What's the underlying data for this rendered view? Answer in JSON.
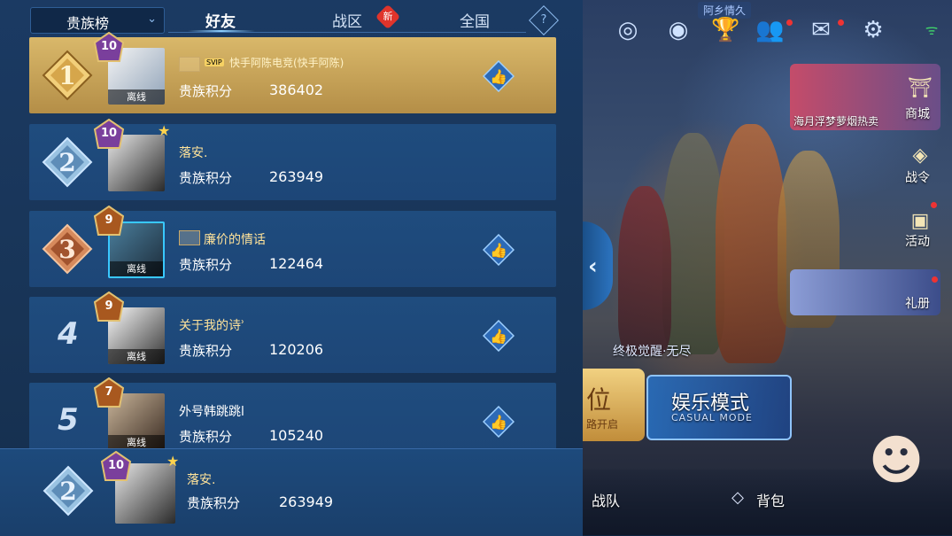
{
  "header": {
    "rank_select": "贵族榜",
    "tabs": [
      {
        "label": "好友",
        "active": true
      },
      {
        "label": "战区",
        "active": false,
        "badge": "新"
      },
      {
        "label": "全国",
        "active": false
      }
    ],
    "help_glyph": "?"
  },
  "colors": {
    "panel": "#1b3a63",
    "row": "#1f4c7e",
    "first_row": "#d9b86a",
    "accent": "#8fd0ff"
  },
  "rows": [
    {
      "rank": "1",
      "level": "10",
      "status": "离线",
      "badge": "SVIP",
      "name": "快手阿陈电竞(快手阿陈)",
      "score_label": "贵族积分",
      "score": "386402",
      "like": true
    },
    {
      "rank": "2",
      "level": "10",
      "status": "",
      "name": "落安.",
      "score_label": "贵族积分",
      "score": "263949",
      "like": false
    },
    {
      "rank": "3",
      "level": "9",
      "status": "离线",
      "name": "廉价的情话",
      "score_label": "贵族积分",
      "score": "122464",
      "like": true
    },
    {
      "rank": "4",
      "level": "9",
      "status": "离线",
      "name": "关于我的诗ʾ",
      "score_label": "贵族积分",
      "score": "120206",
      "like": true
    },
    {
      "rank": "5",
      "level": "7",
      "status": "离线",
      "name": "外号韩跳跳l",
      "score_label": "贵族积分",
      "score": "105240",
      "like": true
    }
  ],
  "me": {
    "rank": "2",
    "level": "10",
    "name": "落安.",
    "score_label": "贵族积分",
    "score": "263949"
  },
  "lobby": {
    "tag": "阿乡情久",
    "shop_card": "海月浮梦萝烟热卖",
    "shop": "商城",
    "battlepass": "战令",
    "events": "活动",
    "gifts": "礼册",
    "mode_banner": "终极觉醒·无尽",
    "mode_left": "位",
    "mode_left_sub": "路开启",
    "mode_right": "娱乐模式",
    "mode_right_en": "CASUAL MODE",
    "bottom_team": "战队",
    "bottom_bag": "背包"
  }
}
